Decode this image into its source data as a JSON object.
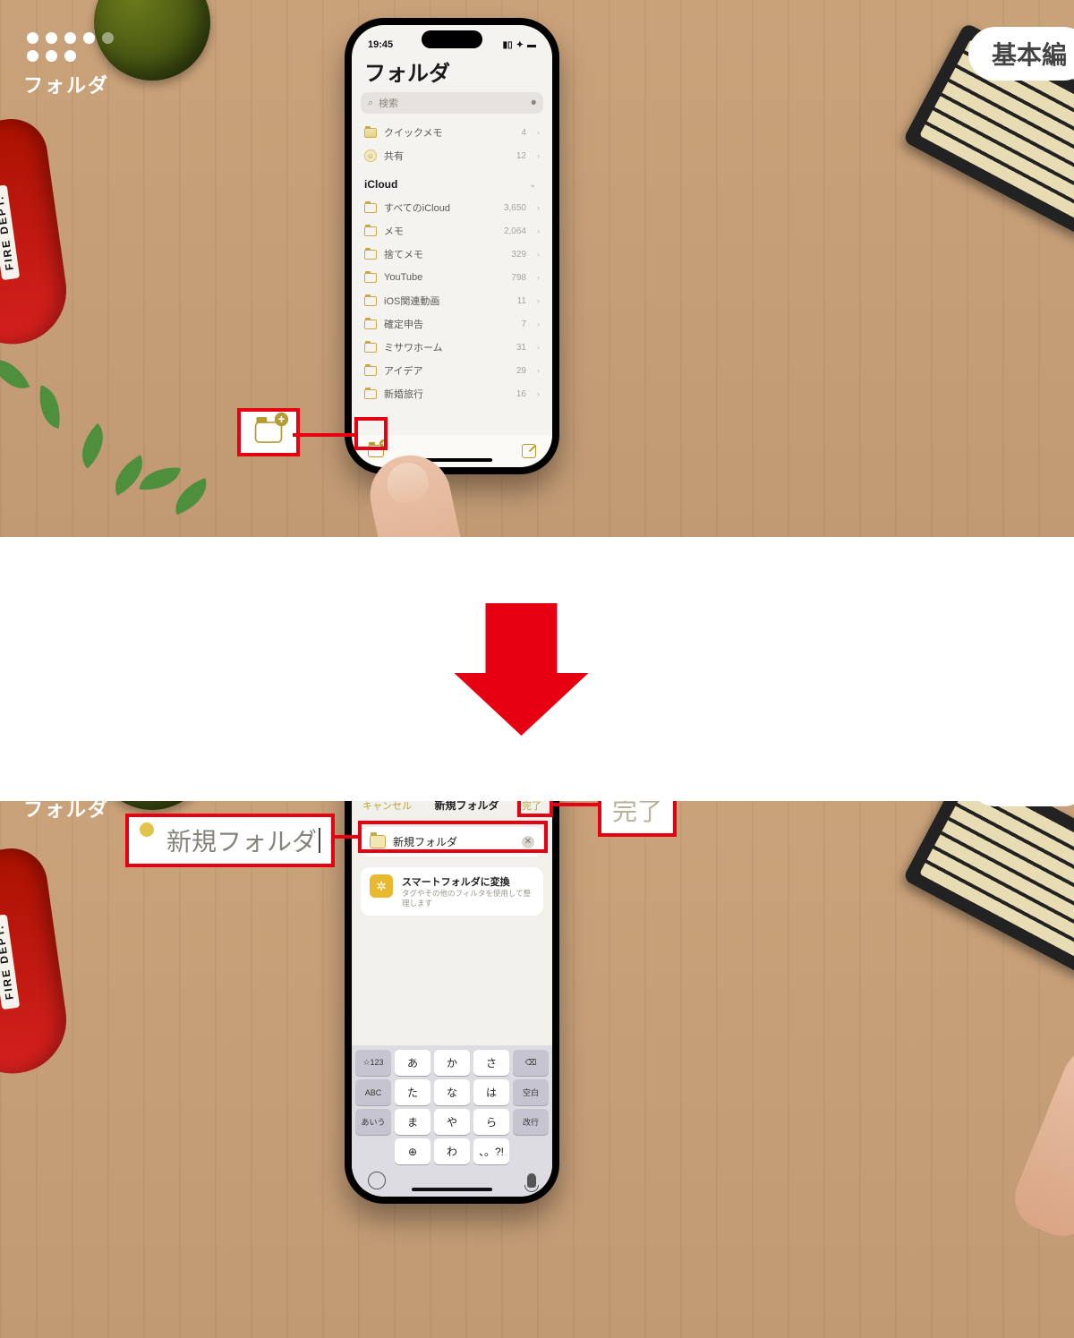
{
  "overlay": {
    "label": "フォルダ",
    "pill": "基本編",
    "car_text": "FIRE DEPT."
  },
  "status": {
    "time": "19:45"
  },
  "screen1": {
    "title": "フォルダ",
    "search_placeholder": "検索",
    "quick": [
      {
        "label": "クイックメモ",
        "count": "4"
      },
      {
        "label": "共有",
        "count": "12"
      }
    ],
    "section": "iCloud",
    "folders": [
      {
        "label": "すべてのiCloud",
        "count": "3,650"
      },
      {
        "label": "メモ",
        "count": "2,064"
      },
      {
        "label": "捨てメモ",
        "count": "329"
      },
      {
        "label": "YouTube",
        "count": "798"
      },
      {
        "label": "iOS関連動画",
        "count": "11"
      },
      {
        "label": "確定申告",
        "count": "7"
      },
      {
        "label": "ミサワホーム",
        "count": "31"
      },
      {
        "label": "アイデア",
        "count": "29"
      },
      {
        "label": "新婚旅行",
        "count": "16"
      }
    ]
  },
  "screen2": {
    "cancel": "キャンセル",
    "title": "新規フォルダ",
    "done": "完了",
    "input_value": "新規フォルダ",
    "smart_title": "スマートフォルダに変換",
    "smart_sub": "タグやその他のフィルタを使用して整理します",
    "keyboard": {
      "rows": [
        [
          "☆123",
          "あ",
          "か",
          "さ",
          "⌫"
        ],
        [
          "ABC",
          "た",
          "な",
          "は",
          "空白"
        ],
        [
          "あいう",
          "ま",
          "や",
          "ら",
          "改行"
        ],
        [
          "",
          "⊕",
          "わ",
          "、。?!",
          ""
        ]
      ]
    }
  },
  "callouts": {
    "done_enlarged": "完了",
    "input_enlarged": "新規フォルダ"
  }
}
